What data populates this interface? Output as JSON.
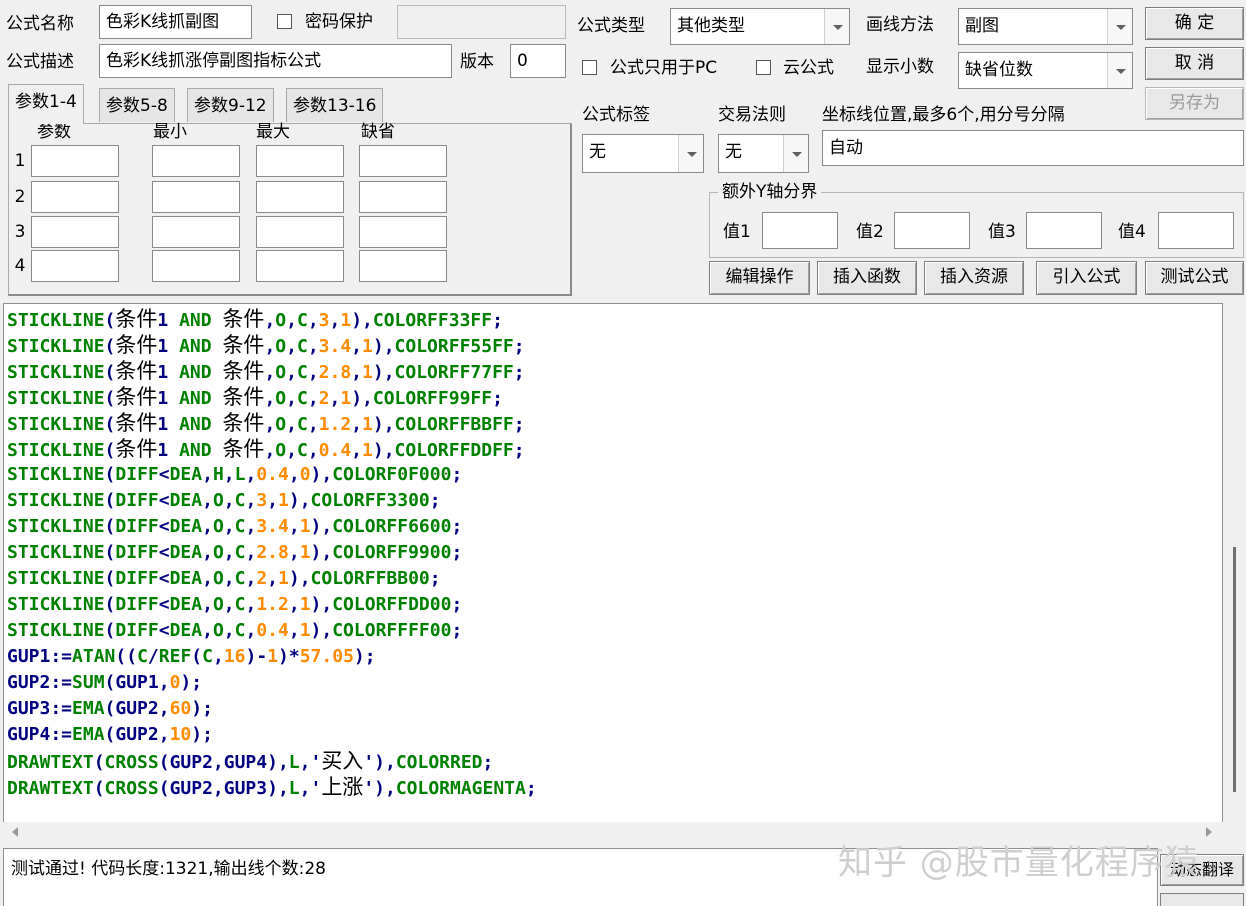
{
  "header": {
    "name_label": "公式名称",
    "name_value": "色彩K线抓副图",
    "password_label": "密码保护",
    "password_value": "",
    "desc_label": "公式描述",
    "desc_value": "色彩K线抓涨停副图指标公式",
    "version_label": "版本",
    "version_value": "0"
  },
  "options": {
    "type_label": "公式类型",
    "type_value": "其他类型",
    "draw_label": "画线方法",
    "draw_value": "副图",
    "pc_only_label": "公式只用于PC",
    "cloud_label": "云公式",
    "decimals_label": "显示小数",
    "decimals_value": "缺省位数"
  },
  "buttons": {
    "ok": "确 定",
    "cancel": "取 消",
    "save_as": "另存为",
    "edit_ops": "编辑操作",
    "insert_func": "插入函数",
    "insert_res": "插入资源",
    "import_formula": "引入公式",
    "test_formula": "测试公式"
  },
  "params": {
    "tabs": [
      "参数1-4",
      "参数5-8",
      "参数9-12",
      "参数13-16"
    ],
    "columns": [
      "参数",
      "最小",
      "最大",
      "缺省"
    ],
    "rows": [
      "1",
      "2",
      "3",
      "4"
    ]
  },
  "tags": {
    "tag_label": "公式标签",
    "tag_value": "无",
    "rule_label": "交易法则",
    "rule_value": "无",
    "coord_label": "坐标线位置,最多6个,用分号分隔",
    "coord_value": "自动"
  },
  "y_axis": {
    "group_label": "额外Y轴分界",
    "labels": [
      "值1",
      "值2",
      "值3",
      "值4"
    ]
  },
  "code_lines": [
    [
      [
        "k",
        "STICKLINE"
      ],
      [
        "p",
        "("
      ],
      [
        "c",
        "条件"
      ],
      [
        "p",
        "1 "
      ],
      [
        "k",
        "AND "
      ],
      [
        "c",
        "条件"
      ],
      [
        "p",
        ","
      ],
      [
        "k",
        "O"
      ],
      [
        "p",
        ","
      ],
      [
        "k",
        "C"
      ],
      [
        "p",
        ","
      ],
      [
        "n",
        "3"
      ],
      [
        "p",
        ","
      ],
      [
        "n",
        "1"
      ],
      [
        "p",
        "),"
      ],
      [
        "k",
        "COLORFF33FF"
      ],
      [
        "p",
        ";"
      ]
    ],
    [
      [
        "k",
        "STICKLINE"
      ],
      [
        "p",
        "("
      ],
      [
        "c",
        "条件"
      ],
      [
        "p",
        "1 "
      ],
      [
        "k",
        "AND "
      ],
      [
        "c",
        "条件"
      ],
      [
        "p",
        ","
      ],
      [
        "k",
        "O"
      ],
      [
        "p",
        ","
      ],
      [
        "k",
        "C"
      ],
      [
        "p",
        ","
      ],
      [
        "n",
        "3.4"
      ],
      [
        "p",
        ","
      ],
      [
        "n",
        "1"
      ],
      [
        "p",
        "),"
      ],
      [
        "k",
        "COLORFF55FF"
      ],
      [
        "p",
        ";"
      ]
    ],
    [
      [
        "k",
        "STICKLINE"
      ],
      [
        "p",
        "("
      ],
      [
        "c",
        "条件"
      ],
      [
        "p",
        "1 "
      ],
      [
        "k",
        "AND "
      ],
      [
        "c",
        "条件"
      ],
      [
        "p",
        ","
      ],
      [
        "k",
        "O"
      ],
      [
        "p",
        ","
      ],
      [
        "k",
        "C"
      ],
      [
        "p",
        ","
      ],
      [
        "n",
        "2.8"
      ],
      [
        "p",
        ","
      ],
      [
        "n",
        "1"
      ],
      [
        "p",
        "),"
      ],
      [
        "k",
        "COLORFF77FF"
      ],
      [
        "p",
        ";"
      ]
    ],
    [
      [
        "k",
        "STICKLINE"
      ],
      [
        "p",
        "("
      ],
      [
        "c",
        "条件"
      ],
      [
        "p",
        "1 "
      ],
      [
        "k",
        "AND "
      ],
      [
        "c",
        "条件"
      ],
      [
        "p",
        ","
      ],
      [
        "k",
        "O"
      ],
      [
        "p",
        ","
      ],
      [
        "k",
        "C"
      ],
      [
        "p",
        ","
      ],
      [
        "n",
        "2"
      ],
      [
        "p",
        ","
      ],
      [
        "n",
        "1"
      ],
      [
        "p",
        "),"
      ],
      [
        "k",
        "COLORFF99FF"
      ],
      [
        "p",
        ";"
      ]
    ],
    [
      [
        "k",
        "STICKLINE"
      ],
      [
        "p",
        "("
      ],
      [
        "c",
        "条件"
      ],
      [
        "p",
        "1 "
      ],
      [
        "k",
        "AND "
      ],
      [
        "c",
        "条件"
      ],
      [
        "p",
        ","
      ],
      [
        "k",
        "O"
      ],
      [
        "p",
        ","
      ],
      [
        "k",
        "C"
      ],
      [
        "p",
        ","
      ],
      [
        "n",
        "1.2"
      ],
      [
        "p",
        ","
      ],
      [
        "n",
        "1"
      ],
      [
        "p",
        "),"
      ],
      [
        "k",
        "COLORFFBBFF"
      ],
      [
        "p",
        ";"
      ]
    ],
    [
      [
        "k",
        "STICKLINE"
      ],
      [
        "p",
        "("
      ],
      [
        "c",
        "条件"
      ],
      [
        "p",
        "1 "
      ],
      [
        "k",
        "AND "
      ],
      [
        "c",
        "条件"
      ],
      [
        "p",
        ","
      ],
      [
        "k",
        "O"
      ],
      [
        "p",
        ","
      ],
      [
        "k",
        "C"
      ],
      [
        "p",
        ","
      ],
      [
        "n",
        "0.4"
      ],
      [
        "p",
        ","
      ],
      [
        "n",
        "1"
      ],
      [
        "p",
        "),"
      ],
      [
        "k",
        "COLORFFDDFF"
      ],
      [
        "p",
        ";"
      ]
    ],
    [
      [
        "k",
        "STICKLINE"
      ],
      [
        "p",
        "("
      ],
      [
        "k",
        "DIFF"
      ],
      [
        "p",
        "<"
      ],
      [
        "k",
        "DEA"
      ],
      [
        "p",
        ","
      ],
      [
        "k",
        "H"
      ],
      [
        "p",
        ","
      ],
      [
        "k",
        "L"
      ],
      [
        "p",
        ","
      ],
      [
        "n",
        "0.4"
      ],
      [
        "p",
        ","
      ],
      [
        "n",
        "0"
      ],
      [
        "p",
        "),"
      ],
      [
        "k",
        "COLORF0F000"
      ],
      [
        "p",
        ";"
      ]
    ],
    [
      [
        "k",
        "STICKLINE"
      ],
      [
        "p",
        "("
      ],
      [
        "k",
        "DIFF"
      ],
      [
        "p",
        "<"
      ],
      [
        "k",
        "DEA"
      ],
      [
        "p",
        ","
      ],
      [
        "k",
        "O"
      ],
      [
        "p",
        ","
      ],
      [
        "k",
        "C"
      ],
      [
        "p",
        ","
      ],
      [
        "n",
        "3"
      ],
      [
        "p",
        ","
      ],
      [
        "n",
        "1"
      ],
      [
        "p",
        "),"
      ],
      [
        "k",
        "COLORFF3300"
      ],
      [
        "p",
        ";"
      ]
    ],
    [
      [
        "k",
        "STICKLINE"
      ],
      [
        "p",
        "("
      ],
      [
        "k",
        "DIFF"
      ],
      [
        "p",
        "<"
      ],
      [
        "k",
        "DEA"
      ],
      [
        "p",
        ","
      ],
      [
        "k",
        "O"
      ],
      [
        "p",
        ","
      ],
      [
        "k",
        "C"
      ],
      [
        "p",
        ","
      ],
      [
        "n",
        "3.4"
      ],
      [
        "p",
        ","
      ],
      [
        "n",
        "1"
      ],
      [
        "p",
        "),"
      ],
      [
        "k",
        "COLORFF6600"
      ],
      [
        "p",
        ";"
      ]
    ],
    [
      [
        "k",
        "STICKLINE"
      ],
      [
        "p",
        "("
      ],
      [
        "k",
        "DIFF"
      ],
      [
        "p",
        "<"
      ],
      [
        "k",
        "DEA"
      ],
      [
        "p",
        ","
      ],
      [
        "k",
        "O"
      ],
      [
        "p",
        ","
      ],
      [
        "k",
        "C"
      ],
      [
        "p",
        ","
      ],
      [
        "n",
        "2.8"
      ],
      [
        "p",
        ","
      ],
      [
        "n",
        "1"
      ],
      [
        "p",
        "),"
      ],
      [
        "k",
        "COLORFF9900"
      ],
      [
        "p",
        ";"
      ]
    ],
    [
      [
        "k",
        "STICKLINE"
      ],
      [
        "p",
        "("
      ],
      [
        "k",
        "DIFF"
      ],
      [
        "p",
        "<"
      ],
      [
        "k",
        "DEA"
      ],
      [
        "p",
        ","
      ],
      [
        "k",
        "O"
      ],
      [
        "p",
        ","
      ],
      [
        "k",
        "C"
      ],
      [
        "p",
        ","
      ],
      [
        "n",
        "2"
      ],
      [
        "p",
        ","
      ],
      [
        "n",
        "1"
      ],
      [
        "p",
        "),"
      ],
      [
        "k",
        "COLORFFBB00"
      ],
      [
        "p",
        ";"
      ]
    ],
    [
      [
        "k",
        "STICKLINE"
      ],
      [
        "p",
        "("
      ],
      [
        "k",
        "DIFF"
      ],
      [
        "p",
        "<"
      ],
      [
        "k",
        "DEA"
      ],
      [
        "p",
        ","
      ],
      [
        "k",
        "O"
      ],
      [
        "p",
        ","
      ],
      [
        "k",
        "C"
      ],
      [
        "p",
        ","
      ],
      [
        "n",
        "1.2"
      ],
      [
        "p",
        ","
      ],
      [
        "n",
        "1"
      ],
      [
        "p",
        "),"
      ],
      [
        "k",
        "COLORFFDD00"
      ],
      [
        "p",
        ";"
      ]
    ],
    [
      [
        "k",
        "STICKLINE"
      ],
      [
        "p",
        "("
      ],
      [
        "k",
        "DIFF"
      ],
      [
        "p",
        "<"
      ],
      [
        "k",
        "DEA"
      ],
      [
        "p",
        ","
      ],
      [
        "k",
        "O"
      ],
      [
        "p",
        ","
      ],
      [
        "k",
        "C"
      ],
      [
        "p",
        ","
      ],
      [
        "n",
        "0.4"
      ],
      [
        "p",
        ","
      ],
      [
        "n",
        "1"
      ],
      [
        "p",
        "),"
      ],
      [
        "k",
        "COLORFFFF00"
      ],
      [
        "p",
        ";"
      ]
    ],
    [
      [
        "p",
        "GUP1:="
      ],
      [
        "k",
        "ATAN"
      ],
      [
        "p",
        "(("
      ],
      [
        "k",
        "C"
      ],
      [
        "p",
        "/"
      ],
      [
        "k",
        "REF"
      ],
      [
        "p",
        "("
      ],
      [
        "k",
        "C"
      ],
      [
        "p",
        ","
      ],
      [
        "n",
        "16"
      ],
      [
        "p",
        ")-"
      ],
      [
        "n",
        "1"
      ],
      [
        "p",
        ")*"
      ],
      [
        "n",
        "57.05"
      ],
      [
        "p",
        ");"
      ]
    ],
    [
      [
        "p",
        "GUP2:="
      ],
      [
        "k",
        "SUM"
      ],
      [
        "p",
        "(GUP1,"
      ],
      [
        "n",
        "0"
      ],
      [
        "p",
        ");"
      ]
    ],
    [
      [
        "p",
        "GUP3:="
      ],
      [
        "k",
        "EMA"
      ],
      [
        "p",
        "(GUP2,"
      ],
      [
        "n",
        "60"
      ],
      [
        "p",
        ");"
      ]
    ],
    [
      [
        "p",
        "GUP4:="
      ],
      [
        "k",
        "EMA"
      ],
      [
        "p",
        "(GUP2,"
      ],
      [
        "n",
        "10"
      ],
      [
        "p",
        ");"
      ]
    ],
    [
      [
        "k",
        "DRAWTEXT"
      ],
      [
        "p",
        "("
      ],
      [
        "k",
        "CROSS"
      ],
      [
        "p",
        "(GUP2,GUP4),"
      ],
      [
        "k",
        "L"
      ],
      [
        "p",
        ",'"
      ],
      [
        "c",
        "买入"
      ],
      [
        "p",
        "'),"
      ],
      [
        "k",
        "COLORRED"
      ],
      [
        "p",
        ";"
      ]
    ],
    [
      [
        "k",
        "DRAWTEXT"
      ],
      [
        "p",
        "("
      ],
      [
        "k",
        "CROSS"
      ],
      [
        "p",
        "(GUP2,GUP3),"
      ],
      [
        "k",
        "L"
      ],
      [
        "p",
        ",'"
      ],
      [
        "c",
        "上涨"
      ],
      [
        "p",
        "'),"
      ],
      [
        "k",
        "COLORMAGENTA"
      ],
      [
        "p",
        ";"
      ]
    ]
  ],
  "status": {
    "message": "测试通过! 代码长度:1321,输出线个数:28",
    "translate_button": "动态翻译"
  },
  "watermark": "知乎 @股市量化程序猿",
  "colors": {
    "keyword": "#008000",
    "number": "#ff8c00",
    "plain": "#000080"
  }
}
